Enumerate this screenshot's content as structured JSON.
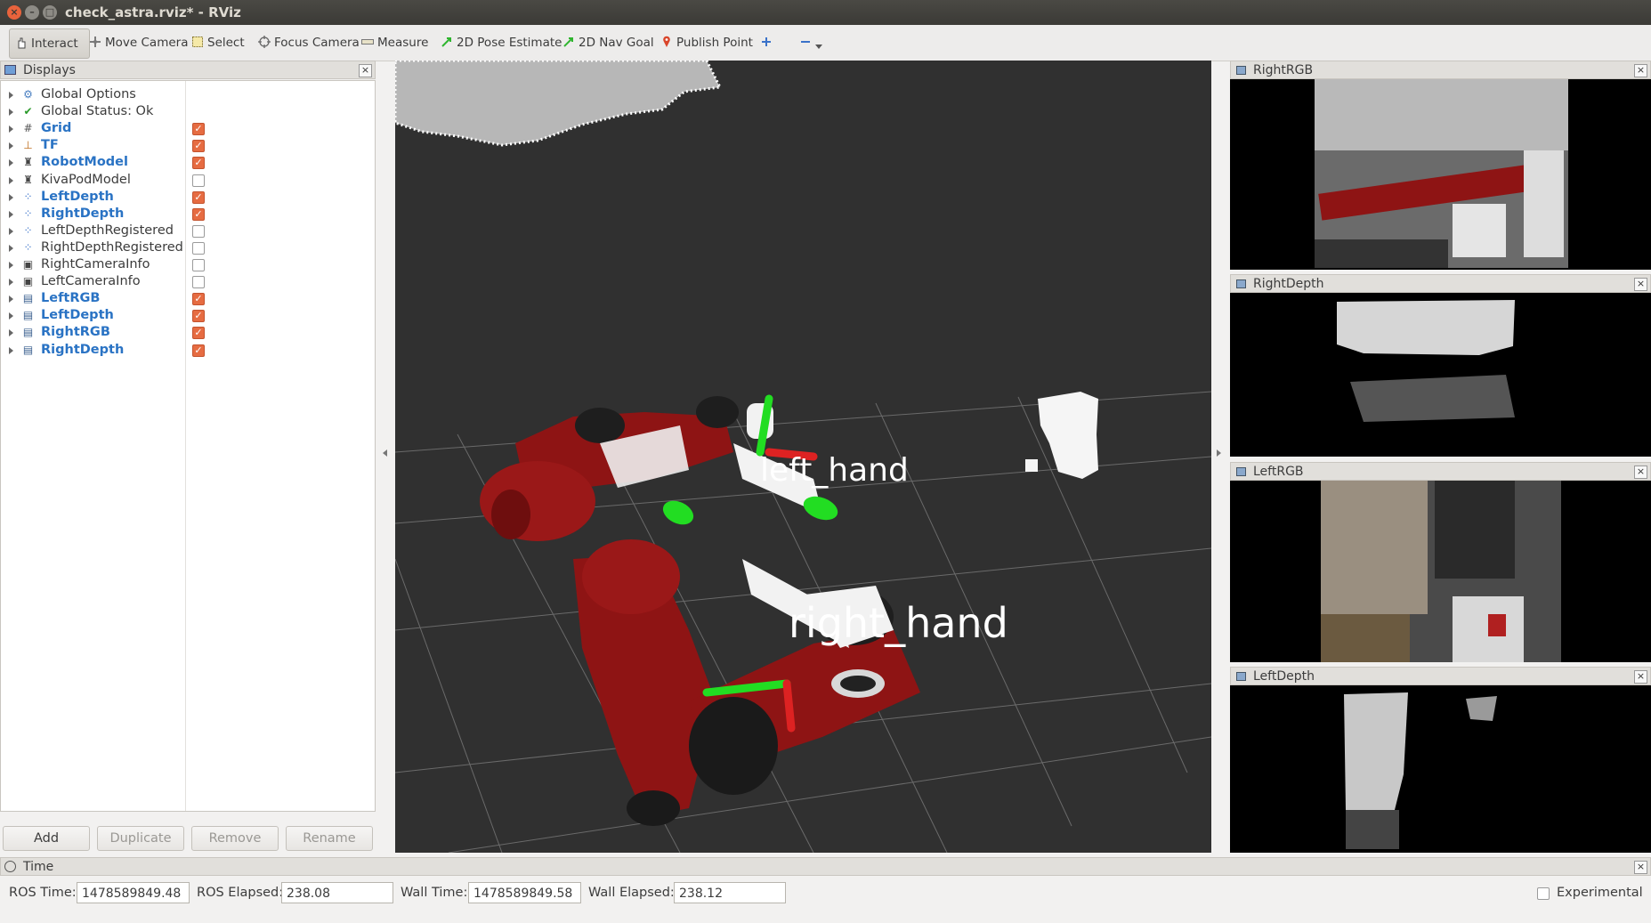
{
  "window": {
    "title": "check_astra.rviz* - RViz",
    "close_glyph": "×",
    "min_glyph": "–",
    "max_glyph": "□"
  },
  "toolbar": {
    "interact": "Interact",
    "move_camera": "Move Camera",
    "select": "Select",
    "focus_camera": "Focus Camera",
    "measure": "Measure",
    "pose_estimate": "2D Pose Estimate",
    "nav_goal": "2D Nav Goal",
    "publish_point": "Publish Point"
  },
  "displays": {
    "title": "Displays",
    "items": [
      {
        "label": "Global Options",
        "icon": "gear-icon",
        "checkbox": null,
        "enabled": false
      },
      {
        "label": "Global Status: Ok",
        "icon": "check-icon",
        "checkbox": null,
        "enabled": false
      },
      {
        "label": "Grid",
        "icon": "grid-icon",
        "checkbox": true,
        "enabled": true
      },
      {
        "label": "TF",
        "icon": "axes-icon",
        "checkbox": true,
        "enabled": true
      },
      {
        "label": "RobotModel",
        "icon": "robot-icon",
        "checkbox": true,
        "enabled": true
      },
      {
        "label": "KivaPodModel",
        "icon": "robot-icon",
        "checkbox": false,
        "enabled": false
      },
      {
        "label": "LeftDepth",
        "icon": "pointcloud-icon",
        "checkbox": true,
        "enabled": true
      },
      {
        "label": "RightDepth",
        "icon": "pointcloud-icon",
        "checkbox": true,
        "enabled": true
      },
      {
        "label": "LeftDepthRegistered",
        "icon": "pointcloud-icon",
        "checkbox": false,
        "enabled": false
      },
      {
        "label": "RightDepthRegistered",
        "icon": "pointcloud-icon",
        "checkbox": false,
        "enabled": false
      },
      {
        "label": "RightCameraInfo",
        "icon": "camera-info-icon",
        "checkbox": false,
        "enabled": false
      },
      {
        "label": "LeftCameraInfo",
        "icon": "camera-info-icon",
        "checkbox": false,
        "enabled": false
      },
      {
        "label": "LeftRGB",
        "icon": "image-icon",
        "checkbox": true,
        "enabled": true
      },
      {
        "label": "LeftDepth",
        "icon": "image-icon",
        "checkbox": true,
        "enabled": true
      },
      {
        "label": "RightRGB",
        "icon": "image-icon",
        "checkbox": true,
        "enabled": true
      },
      {
        "label": "RightDepth",
        "icon": "image-icon",
        "checkbox": true,
        "enabled": true
      }
    ],
    "buttons": {
      "add": "Add",
      "duplicate": "Duplicate",
      "remove": "Remove",
      "rename": "Rename"
    }
  },
  "view3d": {
    "left_label": "left_hand",
    "right_label": "right_hand"
  },
  "image_panels": {
    "right_rgb": "RightRGB",
    "right_depth": "RightDepth",
    "left_rgb": "LeftRGB",
    "left_depth": "LeftDepth"
  },
  "time": {
    "title": "Time",
    "ros_time_label": "ROS Time:",
    "ros_time": "1478589849.48",
    "ros_elapsed_label": "ROS Elapsed:",
    "ros_elapsed": "238.08",
    "wall_time_label": "Wall Time:",
    "wall_time": "1478589849.58",
    "wall_elapsed_label": "Wall Elapsed:",
    "wall_elapsed": "238.12",
    "experimental_label": "Experimental",
    "experimental_checked": false
  },
  "colors": {
    "enabled_label": "#2a73c4",
    "checkbox_on": "#e66c42",
    "view_bg": "#303030",
    "robot_red": "#8e1414"
  }
}
